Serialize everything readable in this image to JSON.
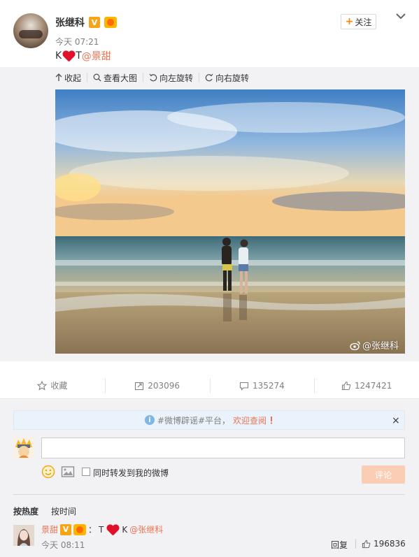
{
  "post": {
    "author": "张继科",
    "verified_badge": "V",
    "time": "今天 07:21",
    "text_before": "K",
    "text_after": "T",
    "mention": "@景甜",
    "follow_label": "关注"
  },
  "media_tools": {
    "collapse": "收起",
    "view_large": "查看大图",
    "rotate_left": "向左旋转",
    "rotate_right": "向右旋转"
  },
  "photo": {
    "watermark": "@张继科"
  },
  "actions": {
    "favorite": "收藏",
    "repost_count": "203096",
    "comment_count": "135274",
    "like_count": "1247421"
  },
  "notice": {
    "text": "#微博辟谣#平台，",
    "link": "欢迎查阅",
    "close": "×"
  },
  "composer": {
    "input_value": "",
    "repost_label": "同时转发到我的微博",
    "submit_label": "评论"
  },
  "sort": {
    "hot": "按热度",
    "time": "按时间"
  },
  "comment": {
    "author": "景甜",
    "verified_badge": "V",
    "sep": "：",
    "text_before": "T",
    "text_after": "K",
    "mention": "@张继科",
    "time": "今天 08:11",
    "reply_label": "回复",
    "like_count": "196836"
  },
  "colors": {
    "accent": "#eb7350",
    "orange": "#ff8200",
    "heart": "#e0112a",
    "panel_bg": "#f2f2f5"
  }
}
